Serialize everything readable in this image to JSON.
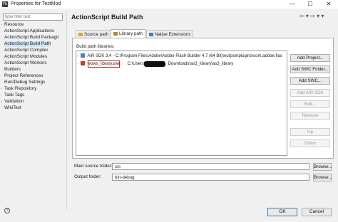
{
  "window": {
    "title": "Properties for TestMod",
    "minimize": "—",
    "maximize": "☐",
    "close": "✕",
    "app_icon": "Fb"
  },
  "filter": {
    "placeholder": "type filter text"
  },
  "tree": {
    "items": [
      {
        "label": "Resource",
        "expandable": true
      },
      {
        "label": "ActionScript Applications"
      },
      {
        "label": "ActionScript Build Packagir"
      },
      {
        "label": "ActionScript Build Path",
        "selected": true
      },
      {
        "label": "ActionScript Compiler"
      },
      {
        "label": "ActionScript Modules"
      },
      {
        "label": "ActionScript Workers"
      },
      {
        "label": "Builders"
      },
      {
        "label": "Project References"
      },
      {
        "label": "Run/Debug Settings"
      },
      {
        "label": "Task Repository",
        "expandable": true
      },
      {
        "label": "Task Tags"
      },
      {
        "label": "Validation",
        "expandable": true
      },
      {
        "label": "WikiText"
      }
    ]
  },
  "header": {
    "title": "ActionScript Build Path",
    "nav_icons": "⇦ ▾ ⇨ ▾ ▾"
  },
  "tabs": [
    {
      "label": "Source path",
      "active": false,
      "icon_color": "#d9a63a"
    },
    {
      "label": "Library path",
      "active": true,
      "icon_color": "#b08a3c"
    },
    {
      "label": "Native Extensions",
      "active": false,
      "icon_color": "#4a7bb5"
    }
  ],
  "library": {
    "label": "Build path libraries:",
    "rows": [
      {
        "caret": "›",
        "name": "AIR SDK 3.4 - C:\\Program Files\\Adobe\\Adobe Flash Builder 4.7 (64 Bit)\\eclipse\\plugins\\com.adobe.flas",
        "icon_color": "#4f7fbf"
      },
      {
        "caret": "›",
        "name": "wows_library.swc",
        "path_prefix": "C:\\Users\\",
        "path_suffix": "Downloads\\as3_library\\as3_library",
        "icon_color": "#c0392b"
      }
    ]
  },
  "buttons": {
    "add_project": "Add Project...",
    "add_swc_folder": "Add SWC Folder...",
    "add_swc": "Add SWC...",
    "add_air_sdk": "Add AIR SDK",
    "edit": "Edit...",
    "remove": "Remove",
    "up": "Up",
    "down": "Down"
  },
  "folders": {
    "main_source_label": "Main source folder:",
    "main_source_value": "src",
    "output_label": "Output folder:",
    "output_value": "bin-debug",
    "browse": "Browse..."
  },
  "dialog": {
    "help": "?",
    "ok": "OK",
    "cancel": "Cancel"
  },
  "colors": {
    "selection": "#cfe4f7",
    "highlight": "#d11a1a",
    "ok_border": "#3c7fb1"
  }
}
